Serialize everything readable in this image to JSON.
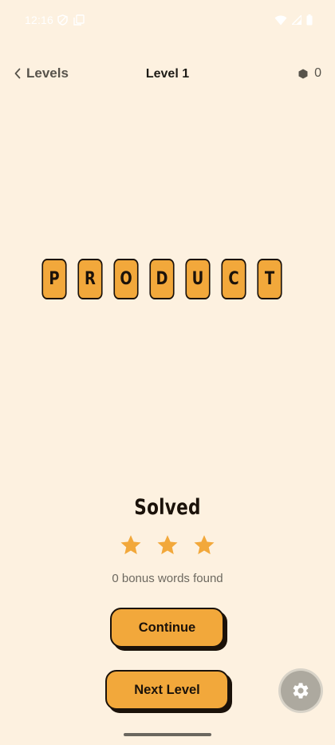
{
  "status_bar": {
    "time": "12:16",
    "left_icons": [
      "shield-icon",
      "screenshot-icon"
    ],
    "right_icons": [
      "wifi-icon",
      "signal-icon",
      "battery-icon"
    ]
  },
  "header": {
    "back_label": "Levels",
    "title": "Level 1",
    "coin_count": "0",
    "coin_icon": "hexagon-icon"
  },
  "puzzle": {
    "word_letters": [
      "P",
      "R",
      "O",
      "D",
      "U",
      "C",
      "T"
    ]
  },
  "result": {
    "title": "Solved",
    "stars_earned": 3,
    "stars_total": 3,
    "bonus_text": "0 bonus words found"
  },
  "actions": {
    "continue_label": "Continue",
    "next_level_label": "Next Level"
  },
  "colors": {
    "background": "#fdf1e0",
    "accent": "#f2a83b",
    "outline": "#1b120a",
    "star": "#f2a83b"
  }
}
